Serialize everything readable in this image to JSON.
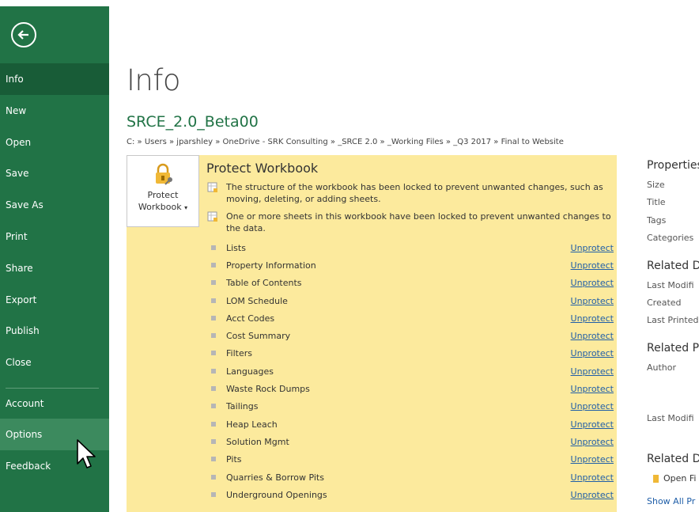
{
  "sidebar": {
    "back_label": "Back",
    "items": [
      {
        "label": "Info"
      },
      {
        "label": "New"
      },
      {
        "label": "Open"
      },
      {
        "label": "Save"
      },
      {
        "label": "Save As"
      },
      {
        "label": "Print"
      },
      {
        "label": "Share"
      },
      {
        "label": "Export"
      },
      {
        "label": "Publish"
      },
      {
        "label": "Close"
      },
      {
        "label": "Account"
      },
      {
        "label": "Options"
      },
      {
        "label": "Feedback"
      }
    ]
  },
  "main": {
    "title": "Info",
    "filename": "SRCE_2.0_Beta00",
    "path": "C: » Users » jparshley » OneDrive - SRK Consulting » _SRCE 2.0 » _Working Files » _Q3 2017 » Final to Website"
  },
  "protect": {
    "button_line1": "Protect",
    "button_line2": "Workbook",
    "heading": "Protect Workbook",
    "msg1": "The structure of the workbook has been locked to prevent unwanted changes, such as moving, deleting, or adding sheets.",
    "msg2": "One or more sheets in this workbook have been locked to prevent unwanted changes to the data.",
    "unprotect_label": "Unprotect",
    "sheets": [
      {
        "name": "Lists"
      },
      {
        "name": "Property Information"
      },
      {
        "name": "Table of Contents"
      },
      {
        "name": "LOM Schedule"
      },
      {
        "name": "Acct Codes"
      },
      {
        "name": "Cost Summary"
      },
      {
        "name": "Filters"
      },
      {
        "name": "Languages"
      },
      {
        "name": "Waste Rock Dumps"
      },
      {
        "name": "Tailings"
      },
      {
        "name": "Heap Leach"
      },
      {
        "name": "Solution Mgmt"
      },
      {
        "name": "Pits"
      },
      {
        "name": "Quarries & Borrow Pits"
      },
      {
        "name": "Underground Openings"
      }
    ]
  },
  "properties": {
    "heading": "Properties",
    "labels": [
      "Size",
      "Title",
      "Tags",
      "Categories"
    ],
    "related_dates_heading": "Related D",
    "date_labels": [
      "Last Modifi",
      "Created",
      "Last Printed"
    ],
    "related_people_heading": "Related Pe",
    "author_label": "Author",
    "last_modified_by_label": "Last Modifi",
    "related_docs_heading": "Related D",
    "open_file_label": "Open Fi",
    "show_all_label": "Show All Pr"
  }
}
